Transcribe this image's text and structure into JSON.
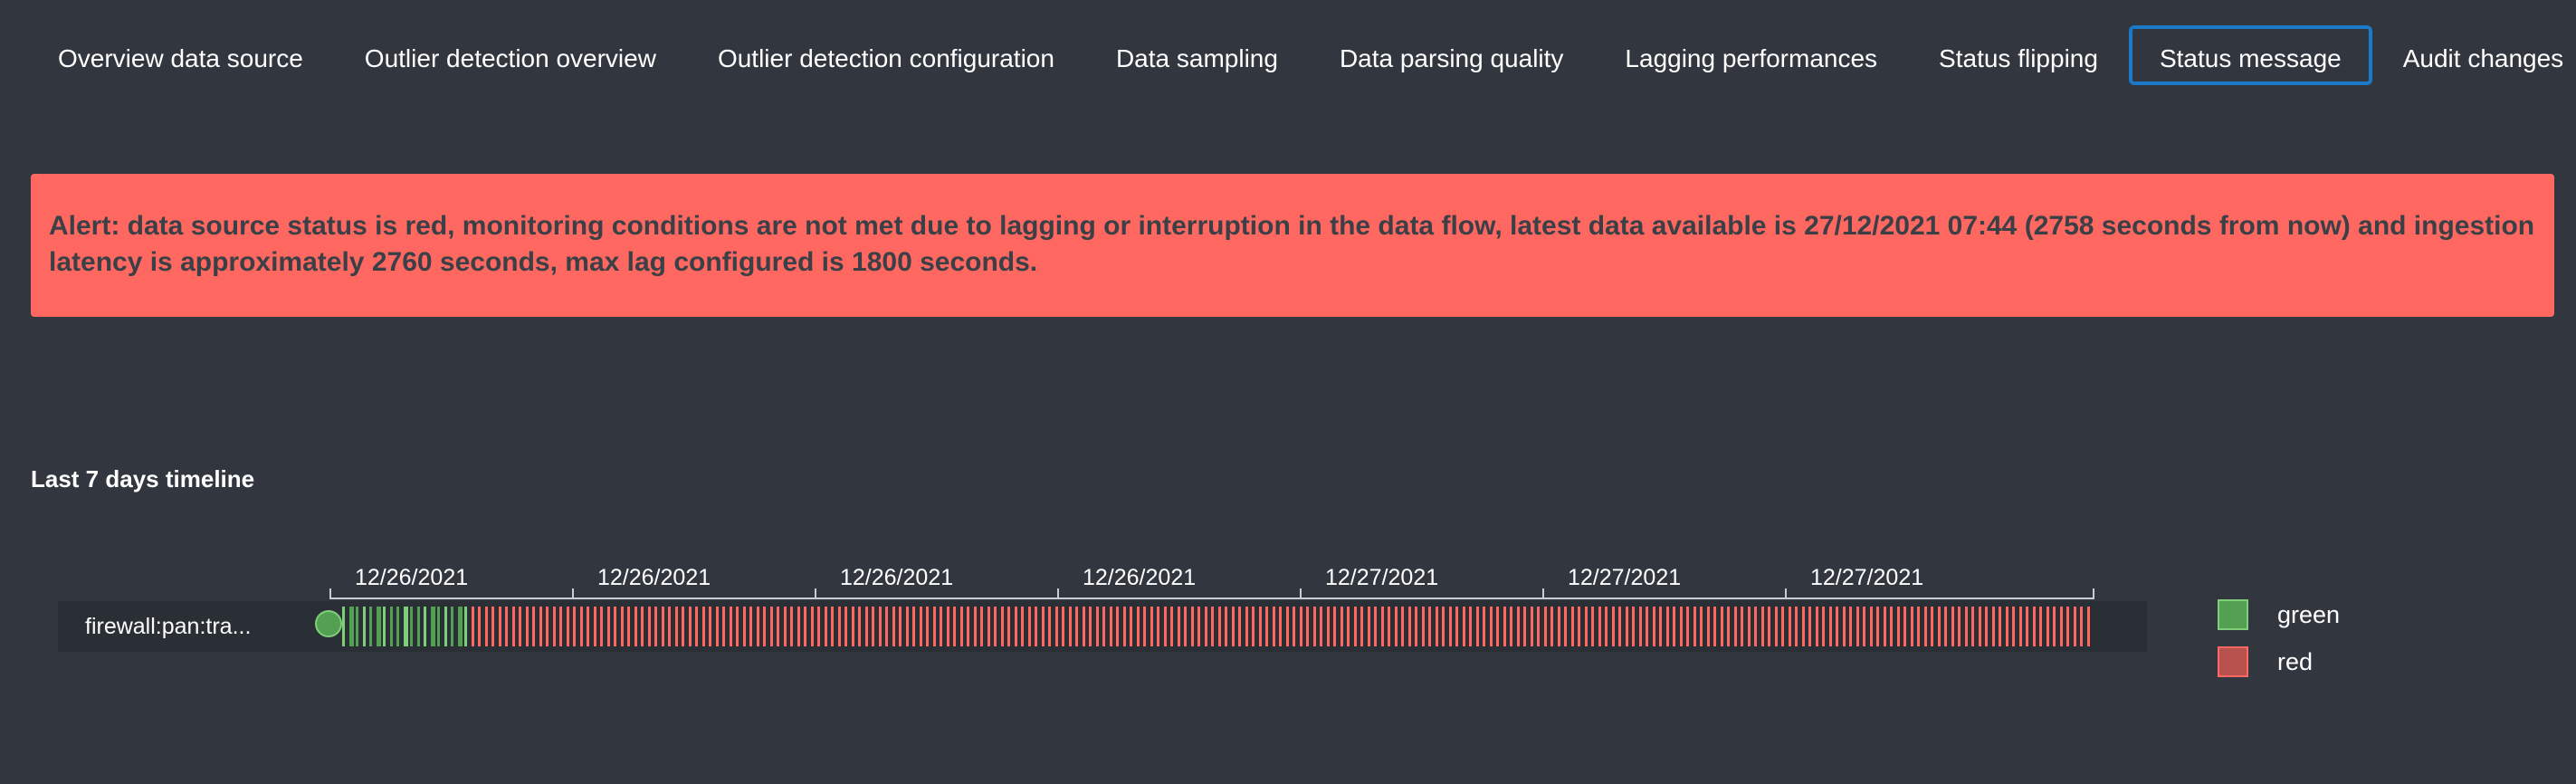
{
  "tabs": [
    {
      "label": "Overview data source",
      "active": false
    },
    {
      "label": "Outlier detection overview",
      "active": false
    },
    {
      "label": "Outlier detection configuration",
      "active": false
    },
    {
      "label": "Data sampling",
      "active": false
    },
    {
      "label": "Data parsing quality",
      "active": false
    },
    {
      "label": "Lagging performances",
      "active": false
    },
    {
      "label": "Status flipping",
      "active": false
    },
    {
      "label": "Status message",
      "active": true
    },
    {
      "label": "Audit changes",
      "active": false
    }
  ],
  "alert": {
    "text": "Alert: data source status is red, monitoring conditions are not met due to lagging or interruption in the data flow, latest data available is 27/12/2021 07:44 (2758 seconds from now) and ingestion latency is approximately 2760 seconds, max lag configured is 1800 seconds."
  },
  "timeline": {
    "title": "Last 7 days timeline",
    "row_label": "firewall:pan:tra...",
    "dates": [
      "12/26/2021",
      "12/26/2021",
      "12/26/2021",
      "12/26/2021",
      "12/27/2021",
      "12/27/2021",
      "12/27/2021"
    ],
    "green_fraction": 0.075,
    "colors": {
      "green": "#53a052",
      "red": "#ff6861"
    }
  },
  "legend": [
    {
      "label": "green",
      "color": "#53a052",
      "border": "#7fcf7a"
    },
    {
      "label": "red",
      "color": "#b8524e",
      "border": "#ff6861"
    }
  ]
}
